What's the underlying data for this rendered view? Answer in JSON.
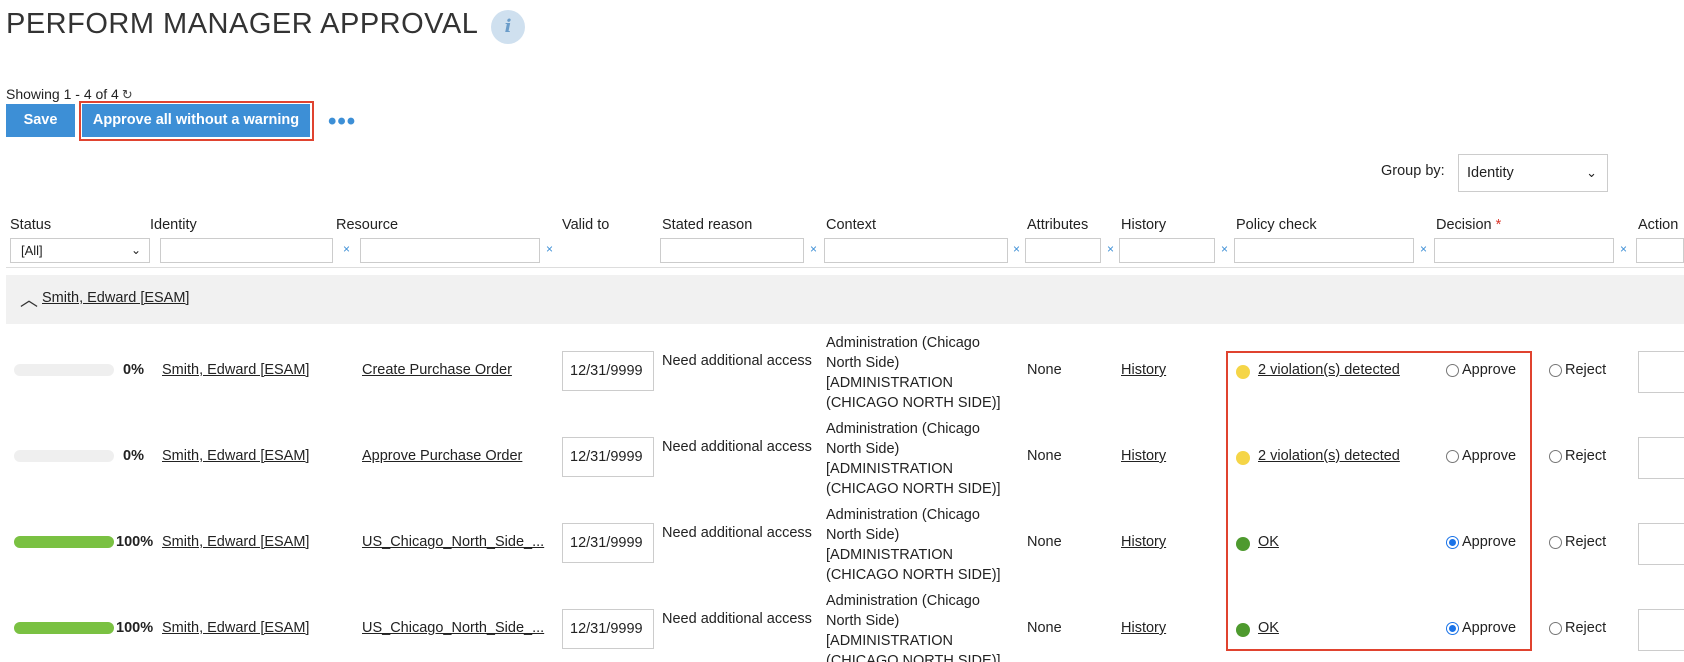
{
  "page": {
    "title": "PERFORM MANAGER APPROVAL",
    "info_icon_glyph": "i",
    "showing": "Showing 1 - 4 of 4",
    "refresh_glyph": "↻"
  },
  "toolbar": {
    "save_label": "Save",
    "approve_all_label": "Approve all without a warning",
    "more_label": "•••"
  },
  "group_by": {
    "label": "Group by:",
    "value": "Identity"
  },
  "columns": {
    "status": "Status",
    "identity": "Identity",
    "resource": "Resource",
    "valid_to": "Valid to",
    "stated_reason": "Stated reason",
    "context": "Context",
    "attributes": "Attributes",
    "history": "History",
    "policy_check": "Policy check",
    "decision": "Decision",
    "decision_required": "*",
    "action": "Action"
  },
  "filters": {
    "status_value": "[All]",
    "clear_glyph": "×"
  },
  "group": {
    "collapse_glyph": "︿",
    "label": "Smith, Edward [ESAM]"
  },
  "rows": [
    {
      "progress": 0,
      "progress_label": "0%",
      "identity": "Smith, Edward [ESAM]",
      "resource": "Create Purchase Order",
      "valid_to": "12/31/9999",
      "reason": "Need additional access",
      "context": "Administration (Chicago North Side) [ADMINISTRATION (CHICAGO NORTH SIDE)]",
      "attributes": "None",
      "history": "History",
      "policy": "2 violation(s) detected",
      "policy_color": "#f5d547",
      "approve_label": "Approve",
      "reject_label": "Reject",
      "decision": "none"
    },
    {
      "progress": 0,
      "progress_label": "0%",
      "identity": "Smith, Edward [ESAM]",
      "resource": "Approve Purchase Order",
      "valid_to": "12/31/9999",
      "reason": "Need additional access",
      "context": "Administration (Chicago North Side) [ADMINISTRATION (CHICAGO NORTH SIDE)]",
      "attributes": "None",
      "history": "History",
      "policy": "2 violation(s) detected",
      "policy_color": "#f5d547",
      "approve_label": "Approve",
      "reject_label": "Reject",
      "decision": "none"
    },
    {
      "progress": 100,
      "progress_label": "100%",
      "identity": "Smith, Edward [ESAM]",
      "resource": "US_Chicago_North_Side_...",
      "valid_to": "12/31/9999",
      "reason": "Need additional access",
      "context": "Administration (Chicago North Side) [ADMINISTRATION (CHICAGO NORTH SIDE)]",
      "attributes": "None",
      "history": "History",
      "policy": "OK",
      "policy_color": "#4e9a2e",
      "approve_label": "Approve",
      "reject_label": "Reject",
      "decision": "approve"
    },
    {
      "progress": 100,
      "progress_label": "100%",
      "identity": "Smith, Edward [ESAM]",
      "resource": "US_Chicago_North_Side_...",
      "valid_to": "12/31/9999",
      "reason": "Need additional access",
      "context": "Administration (Chicago North Side) [ADMINISTRATION (CHICAGO NORTH SIDE)]",
      "attributes": "None",
      "history": "History",
      "policy": "OK",
      "policy_color": "#4e9a2e",
      "approve_label": "Approve",
      "reject_label": "Reject",
      "decision": "approve"
    }
  ]
}
